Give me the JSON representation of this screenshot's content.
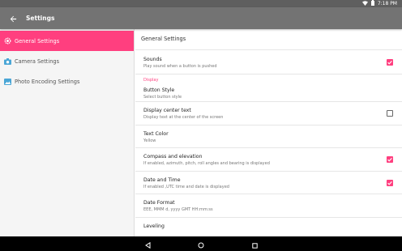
{
  "status_bar": {
    "time": "7:18 PM"
  },
  "app_bar": {
    "title": "Settings"
  },
  "sidebar": {
    "items": [
      {
        "label": "General Settings",
        "icon": "gear-icon"
      },
      {
        "label": "Camera Settings",
        "icon": "camera-icon"
      },
      {
        "label": "Photo Encoding Settings",
        "icon": "image-icon"
      }
    ]
  },
  "content": {
    "title": "General Settings",
    "sounds": {
      "title": "Sounds",
      "summary": "Play sound when a button is pushed",
      "checked": true
    },
    "category_display": "Display",
    "button_style": {
      "title": "Button Style",
      "summary": "Select button style"
    },
    "display_center_text": {
      "title": "Display center text",
      "summary": "Display text at the center of the screen",
      "checked": false
    },
    "text_color": {
      "title": "Text Color",
      "summary": "Yellow"
    },
    "compass": {
      "title": "Compass and elevation",
      "summary": "If enabled, azimuth, pitch, roll angles and bearing is displayed",
      "checked": true
    },
    "date_time": {
      "title": "Date and Time",
      "summary": "If enabled ,UTC time and date is displayed",
      "checked": true
    },
    "date_format": {
      "title": "Date Format",
      "summary": "EEE, MMM d, yyyy GMT HH:mm:ss"
    },
    "leveling": {
      "title": "Leveling"
    }
  },
  "colors": {
    "accent": "#ff3f7f",
    "app_bar": "#737373",
    "status_bar": "#5f5f5f"
  }
}
